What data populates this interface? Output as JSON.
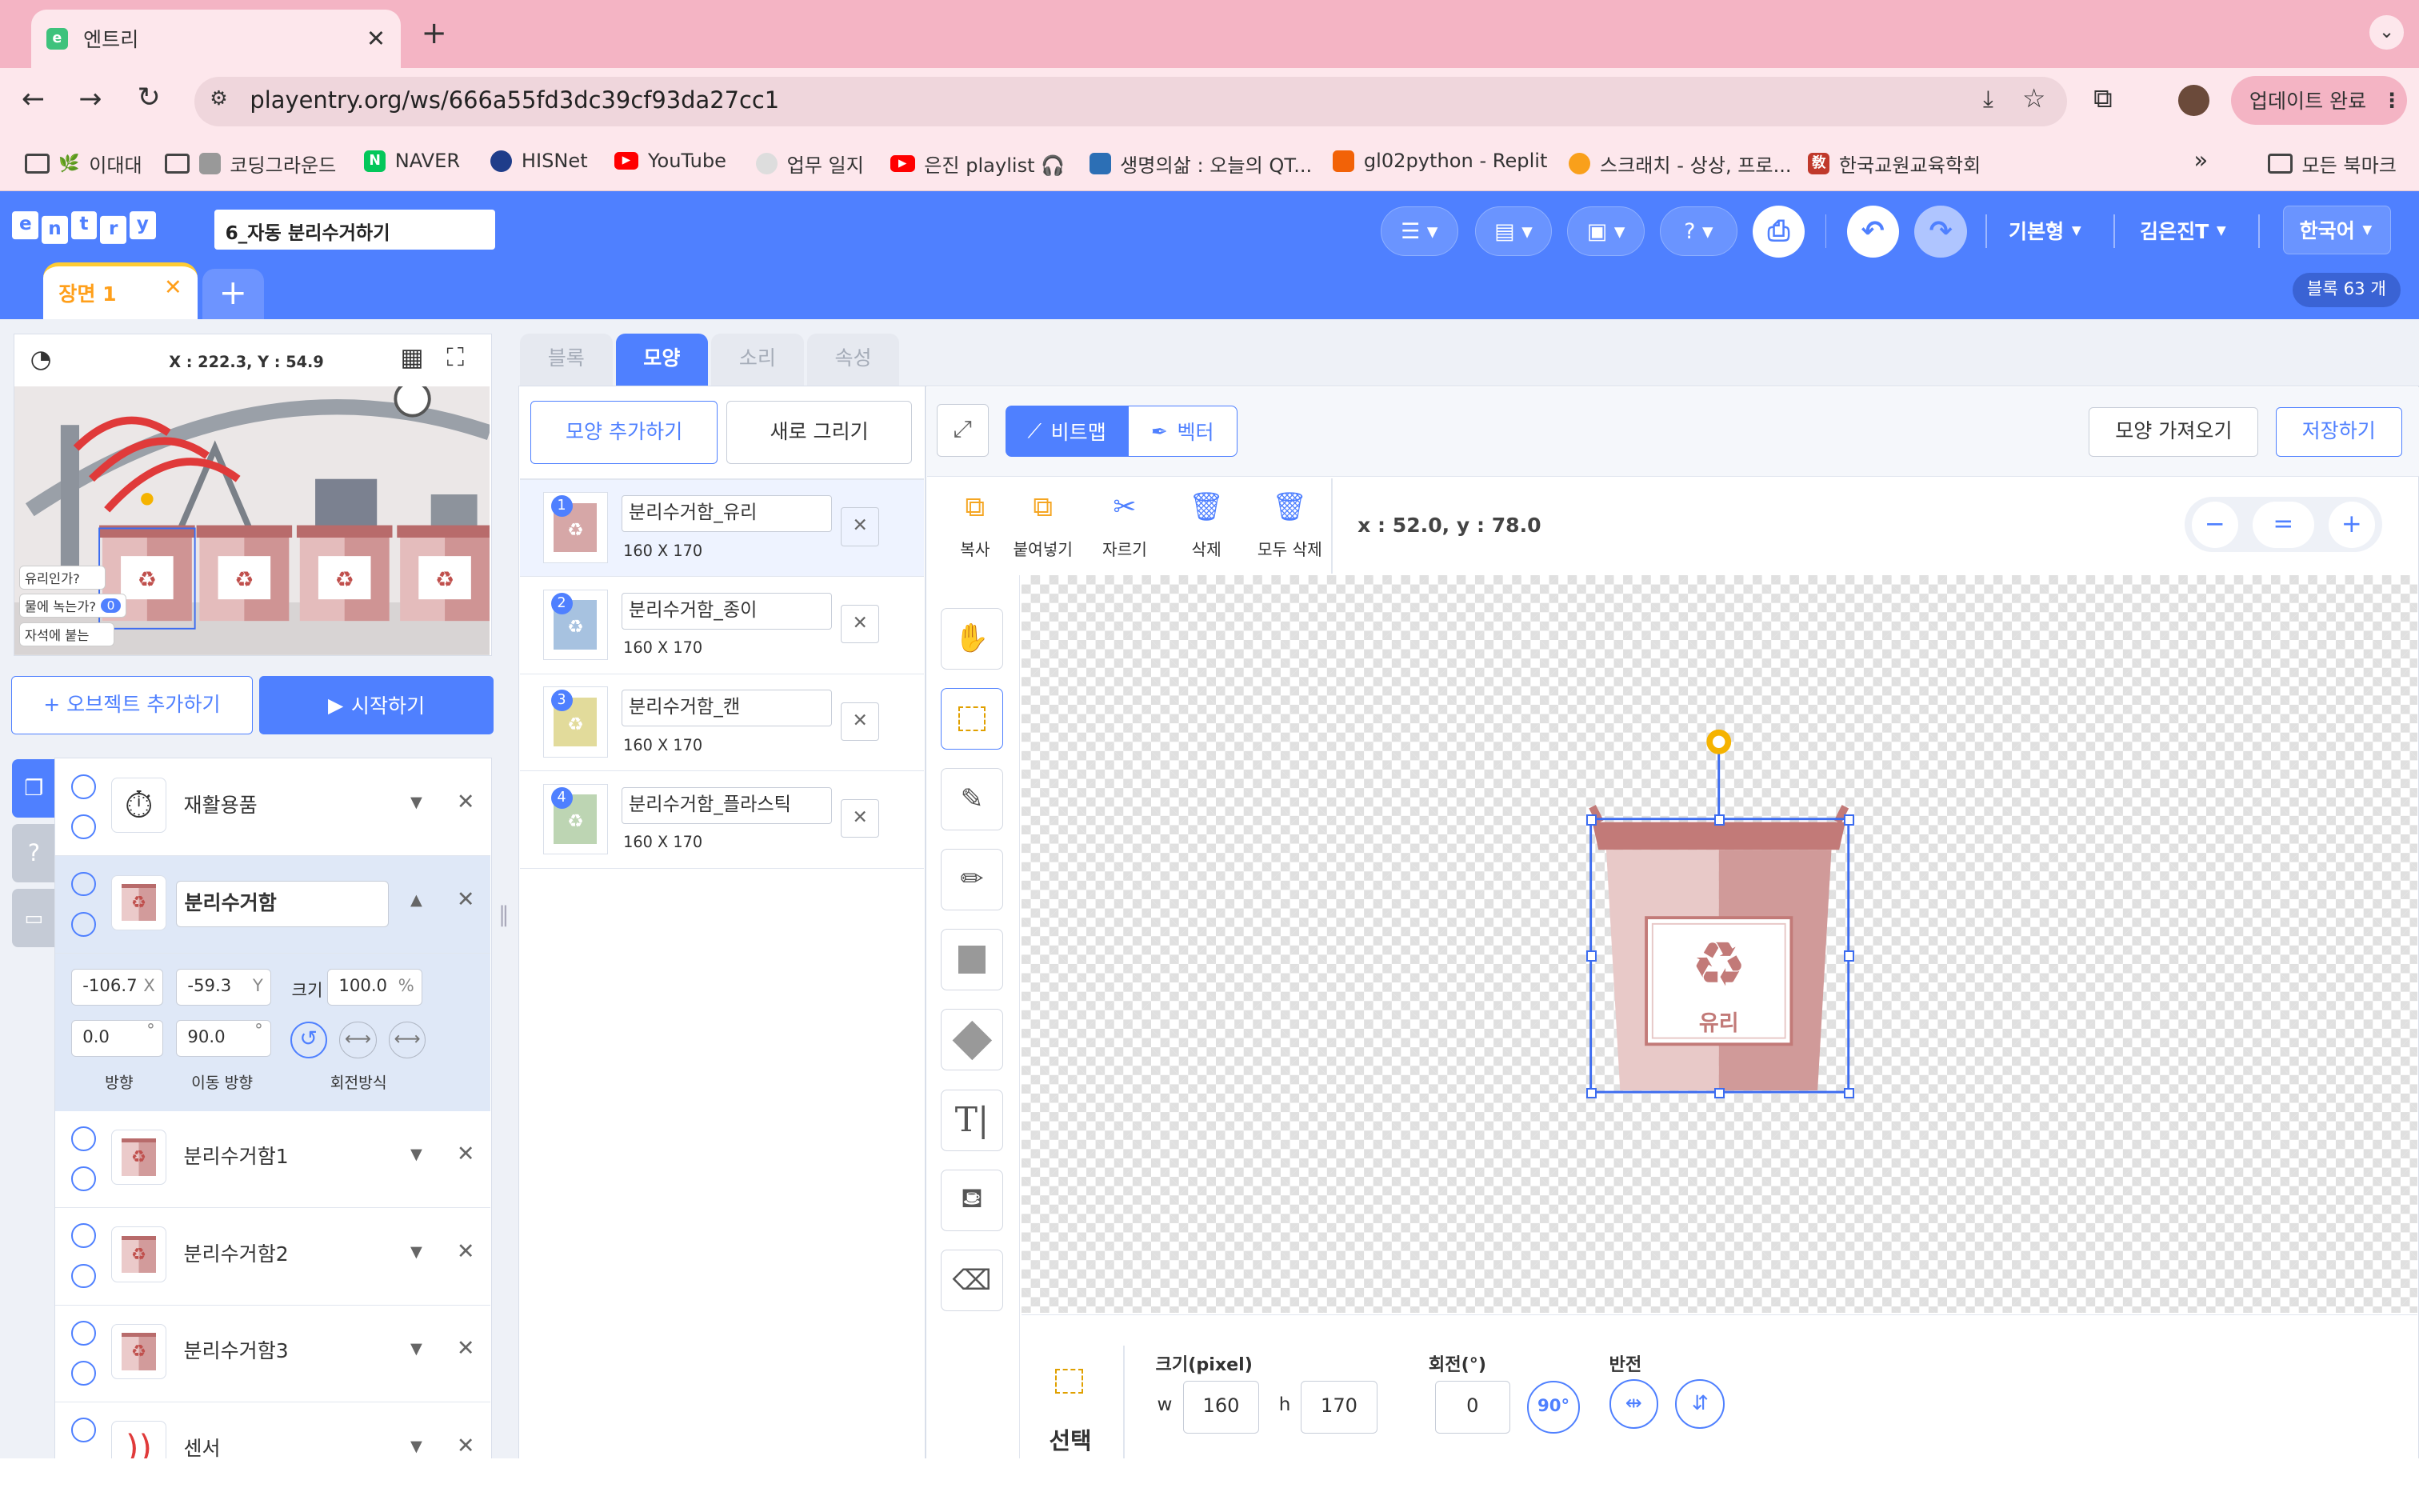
{
  "browser": {
    "tab_title": "엔트리",
    "url": "playentry.org/ws/666a55fd3dc39cf93da27cc1",
    "update_button": "업데이트 완료",
    "bookmarks": [
      "이대대",
      "코딩그라운드",
      "NAVER",
      "HISNet",
      "YouTube",
      "업무 일지",
      "은진 playlist 🎧",
      "생명의삶 : 오늘의 QT...",
      "gl02python - Replit",
      "스크래치 - 상상, 프로...",
      "한국교원교육학회"
    ],
    "all_bookmarks": "모든 북마크",
    "more_bookmarks": "»"
  },
  "entry": {
    "logo": [
      "e",
      "n",
      "t",
      "r",
      "y"
    ],
    "project_name": "6_자동 분리수거하기",
    "scene_tab": "장면 1",
    "add_scene": "+",
    "mode": "기본형",
    "user": "김은진T",
    "language": "한국어",
    "block_count": "블록 63 개"
  },
  "stage": {
    "coords": "X : 222.3, Y : 54.9",
    "var_labels": [
      "유리인가?",
      "물에 녹는가?",
      "자석에 붙는"
    ],
    "var_values": [
      "",
      "0",
      ""
    ],
    "add_object": "+ 오브젝트 추가하기",
    "start": "시작하기"
  },
  "objects": [
    {
      "name": "재활용품",
      "icon": "clock-icon"
    },
    {
      "name": "분리수거함",
      "icon": "recycle-bin-icon",
      "expanded": true
    },
    {
      "name": "분리수거함1",
      "icon": "recycle-bin-icon"
    },
    {
      "name": "분리수거함2",
      "icon": "recycle-bin-icon"
    },
    {
      "name": "분리수거함3",
      "icon": "recycle-bin-icon"
    },
    {
      "name": "센서",
      "icon": "sensor-icon"
    }
  ],
  "object_props": {
    "x": "-106.7",
    "x_label": "X",
    "y": "-59.3",
    "y_label": "Y",
    "size_label": "크기",
    "size": "100.0",
    "size_unit": "%",
    "direction": "0.0",
    "direction_unit": "°",
    "move_direction": "90.0",
    "move_direction_unit": "°",
    "direction_label": "방향",
    "move_direction_label": "이동 방향",
    "rotation_label": "회전방식"
  },
  "tabs": [
    "블록",
    "모양",
    "소리",
    "속성"
  ],
  "shape_panel": {
    "add_shape": "모양 추가하기",
    "new_draw": "새로 그리기",
    "shapes": [
      {
        "num": "1",
        "name": "분리수거함_유리",
        "size": "160 X 170",
        "color": "#c98a8a"
      },
      {
        "num": "2",
        "name": "분리수거함_종이",
        "size": "160 X 170",
        "color": "#8aaed6"
      },
      {
        "num": "3",
        "name": "분리수거함_캔",
        "size": "160 X 170",
        "color": "#d9cf7a"
      },
      {
        "num": "4",
        "name": "분리수거함_플라스틱",
        "size": "160 X 170",
        "color": "#a8c79a"
      }
    ]
  },
  "editor": {
    "bitmap": "비트맵",
    "vector": "벡터",
    "import": "모양 가져오기",
    "save": "저장하기",
    "tools": [
      "복사",
      "붙여넣기",
      "자르기",
      "삭제",
      "모두 삭제"
    ],
    "coords": "x : 52.0, y : 78.0",
    "zoom_out": "−",
    "zoom_reset": "=",
    "zoom_in": "+",
    "image_label": "유리",
    "mode_label": "선택",
    "size_header": "크기(pixel)",
    "w_label": "w",
    "w": "160",
    "h_label": "h",
    "h": "170",
    "rotate_header": "회전(°)",
    "rotate": "0",
    "rotate_90": "90°",
    "flip_header": "반전"
  }
}
